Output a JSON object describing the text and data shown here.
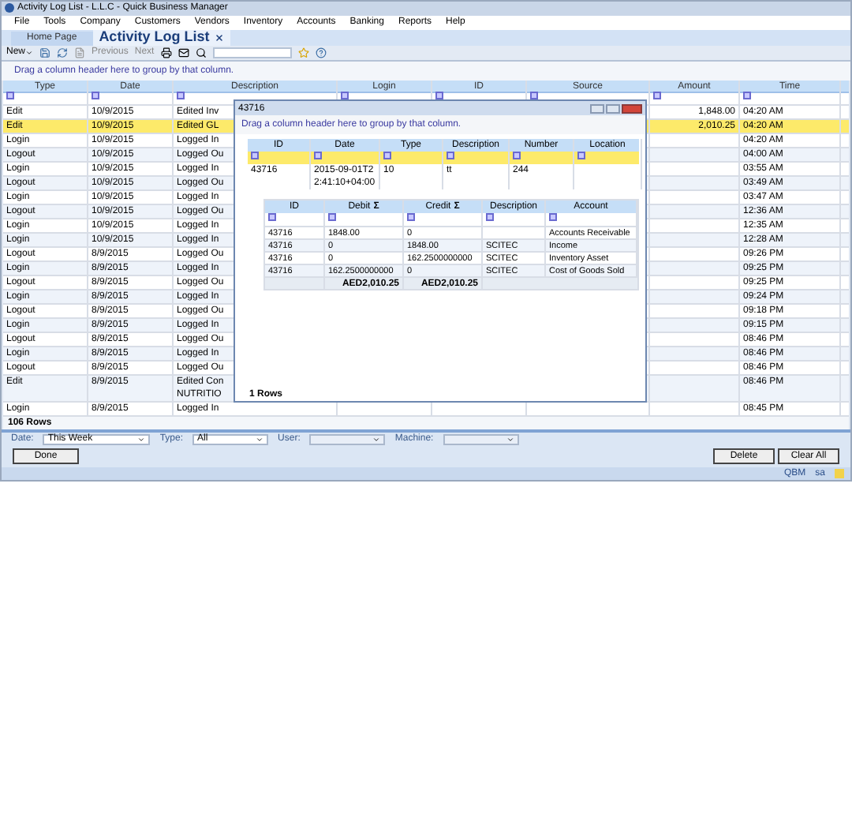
{
  "window": {
    "title": "Activity Log List - L.L.C - Quick Business Manager"
  },
  "menu": [
    "File",
    "Tools",
    "Company",
    "Customers",
    "Vendors",
    "Inventory",
    "Accounts",
    "Banking",
    "Reports",
    "Help"
  ],
  "tabs": [
    {
      "label": "Home Page",
      "selected": false
    },
    {
      "label": "Activity Log List",
      "selected": true
    }
  ],
  "toolbar": {
    "new": "New",
    "previous": "Previous",
    "next": "Next"
  },
  "group_hint": "Drag a column header here to group by that column.",
  "table": {
    "columns": [
      "Type",
      "Date",
      "Description",
      "Login",
      "ID",
      "Source",
      "Amount",
      "Time"
    ],
    "rows": [
      {
        "type": "Edit",
        "date": "10/9/2015",
        "description": "Edited Inv",
        "amount": "1,848.00",
        "time": "04:20 AM",
        "selected": false
      },
      {
        "type": "Edit",
        "date": "10/9/2015",
        "description": "Edited GL",
        "amount": "2,010.25",
        "time": "04:20 AM",
        "selected": true
      },
      {
        "type": "Login",
        "date": "10/9/2015",
        "description": "Logged In",
        "time": "04:20 AM",
        "selected": false
      },
      {
        "type": "Logout",
        "date": "10/9/2015",
        "description": "Logged Ou",
        "time": "04:00 AM",
        "selected": false
      },
      {
        "type": "Login",
        "date": "10/9/2015",
        "description": "Logged In",
        "time": "03:55 AM",
        "selected": false
      },
      {
        "type": "Logout",
        "date": "10/9/2015",
        "description": "Logged Ou",
        "time": "03:49 AM",
        "selected": false
      },
      {
        "type": "Login",
        "date": "10/9/2015",
        "description": "Logged In",
        "time": "03:47 AM",
        "selected": false
      },
      {
        "type": "Logout",
        "date": "10/9/2015",
        "description": "Logged Ou",
        "time": "12:36 AM",
        "selected": false
      },
      {
        "type": "Login",
        "date": "10/9/2015",
        "description": "Logged In",
        "time": "12:35 AM",
        "selected": false
      },
      {
        "type": "Login",
        "date": "10/9/2015",
        "description": "Logged In",
        "time": "12:28 AM",
        "selected": false
      },
      {
        "type": "Logout",
        "date": "8/9/2015",
        "description": "Logged Ou",
        "time": "09:26 PM",
        "selected": false
      },
      {
        "type": "Login",
        "date": "8/9/2015",
        "description": "Logged In",
        "time": "09:25 PM",
        "selected": false
      },
      {
        "type": "Logout",
        "date": "8/9/2015",
        "description": "Logged Ou",
        "time": "09:25 PM",
        "selected": false
      },
      {
        "type": "Login",
        "date": "8/9/2015",
        "description": "Logged In",
        "time": "09:24 PM",
        "selected": false
      },
      {
        "type": "Logout",
        "date": "8/9/2015",
        "description": "Logged Ou",
        "time": "09:18 PM",
        "selected": false
      },
      {
        "type": "Login",
        "date": "8/9/2015",
        "description": "Logged In",
        "time": "09:15 PM",
        "selected": false
      },
      {
        "type": "Logout",
        "date": "8/9/2015",
        "description": "Logged Ou",
        "time": "08:46 PM",
        "selected": false
      },
      {
        "type": "Login",
        "date": "8/9/2015",
        "description": "Logged In",
        "time": "08:46 PM",
        "selected": false
      },
      {
        "type": "Logout",
        "date": "8/9/2015",
        "description": "Logged Ou",
        "time": "08:46 PM",
        "selected": false
      },
      {
        "type": "Edit",
        "date": "8/9/2015",
        "description": "Edited Con\nNUTRITIO",
        "time": "08:46 PM",
        "selected": false
      },
      {
        "type": "Login",
        "date": "8/9/2015",
        "description": "Logged In",
        "time": "08:45 PM",
        "selected": false
      }
    ],
    "row_count": "106 Rows"
  },
  "dialog": {
    "title": "43716",
    "group_hint": "Drag a column header here to group by that column.",
    "columns": [
      "ID",
      "Date",
      "Type",
      "Description",
      "Number",
      "Location"
    ],
    "rows": [
      {
        "id": "43716",
        "date": "2015-09-01T22:41:10+04:00",
        "type": "10",
        "description": "tt",
        "number": "244"
      }
    ],
    "detail": {
      "columns": [
        {
          "label": "ID"
        },
        {
          "label": "Debit",
          "sum": "Σ"
        },
        {
          "label": "Credit",
          "sum": "Σ"
        },
        {
          "label": "Description"
        },
        {
          "label": "Account"
        }
      ],
      "rows": [
        {
          "id": "43716",
          "debit": "1848.00",
          "credit": "0",
          "account": "Accounts Receivable"
        },
        {
          "id": "43716",
          "debit": "0",
          "credit": "1848.00",
          "description": "SCITEC",
          "account": "Income"
        },
        {
          "id": "43716",
          "debit": "0",
          "credit": "162.2500000000",
          "description": "SCITEC",
          "account": "Inventory Asset"
        },
        {
          "id": "43716",
          "debit": "162.2500000000",
          "credit": "0",
          "description": "SCITEC",
          "account": "Cost of Goods Sold"
        }
      ],
      "totals": [
        "AED2,010.25",
        "AED2,010.25"
      ]
    },
    "row_count": "1 Rows"
  },
  "filters": [
    {
      "label": "Date:",
      "value": "This Week"
    },
    {
      "label": "Type:",
      "value": "All"
    },
    {
      "label": "User:"
    },
    {
      "label": "Machine:"
    }
  ],
  "buttons": {
    "left": "Done",
    "right": [
      "Delete",
      "Clear All"
    ]
  },
  "status": [
    "QBM",
    "sa"
  ]
}
